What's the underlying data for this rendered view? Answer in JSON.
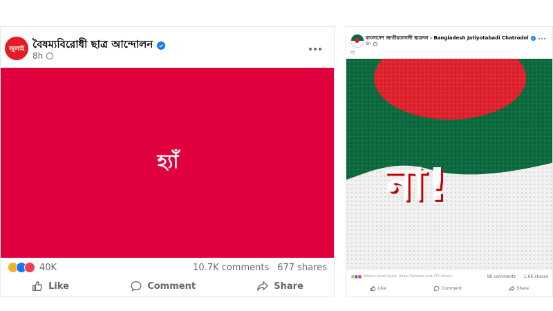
{
  "left_post": {
    "page_name": "বৈষম্যবিরোধী ছাত্র আন্দোলন",
    "avatar_text": "জুলাই",
    "time": "8h",
    "media_text": "হ্যাঁ",
    "media_bg": "#e1003e",
    "reactions": [
      "haha",
      "like",
      "love"
    ],
    "reaction_count": "40K",
    "comments": "10.7K comments",
    "shares": "677 shares",
    "actions": {
      "like": "Like",
      "comment": "Comment",
      "share": "Share"
    }
  },
  "right_post": {
    "page_name": "বাংলাদেশ জাতীয়তাবাদী ছাত্রদল - Bangladesh Jatiyotabadi Chatrodol",
    "time": "8h",
    "caption": "না",
    "media_text": "না!",
    "reactions": [
      "haha",
      "like",
      "love"
    ],
    "reaction_count": "Animul Islam Sujon, Akbar Rahman and 27K others",
    "comments": "9K comments",
    "shares": "1.6K shares",
    "actions": {
      "like": "Like",
      "comment": "Comment",
      "share": "Share"
    }
  },
  "colors": {
    "accent": "#1877f2",
    "brand_red": "#e31b23",
    "flag_green": "#006a4e",
    "flag_red": "#f42a41"
  },
  "icons": [
    "verified-badge-icon",
    "globe-icon",
    "more-icon",
    "like-icon",
    "comment-icon",
    "share-icon"
  ]
}
